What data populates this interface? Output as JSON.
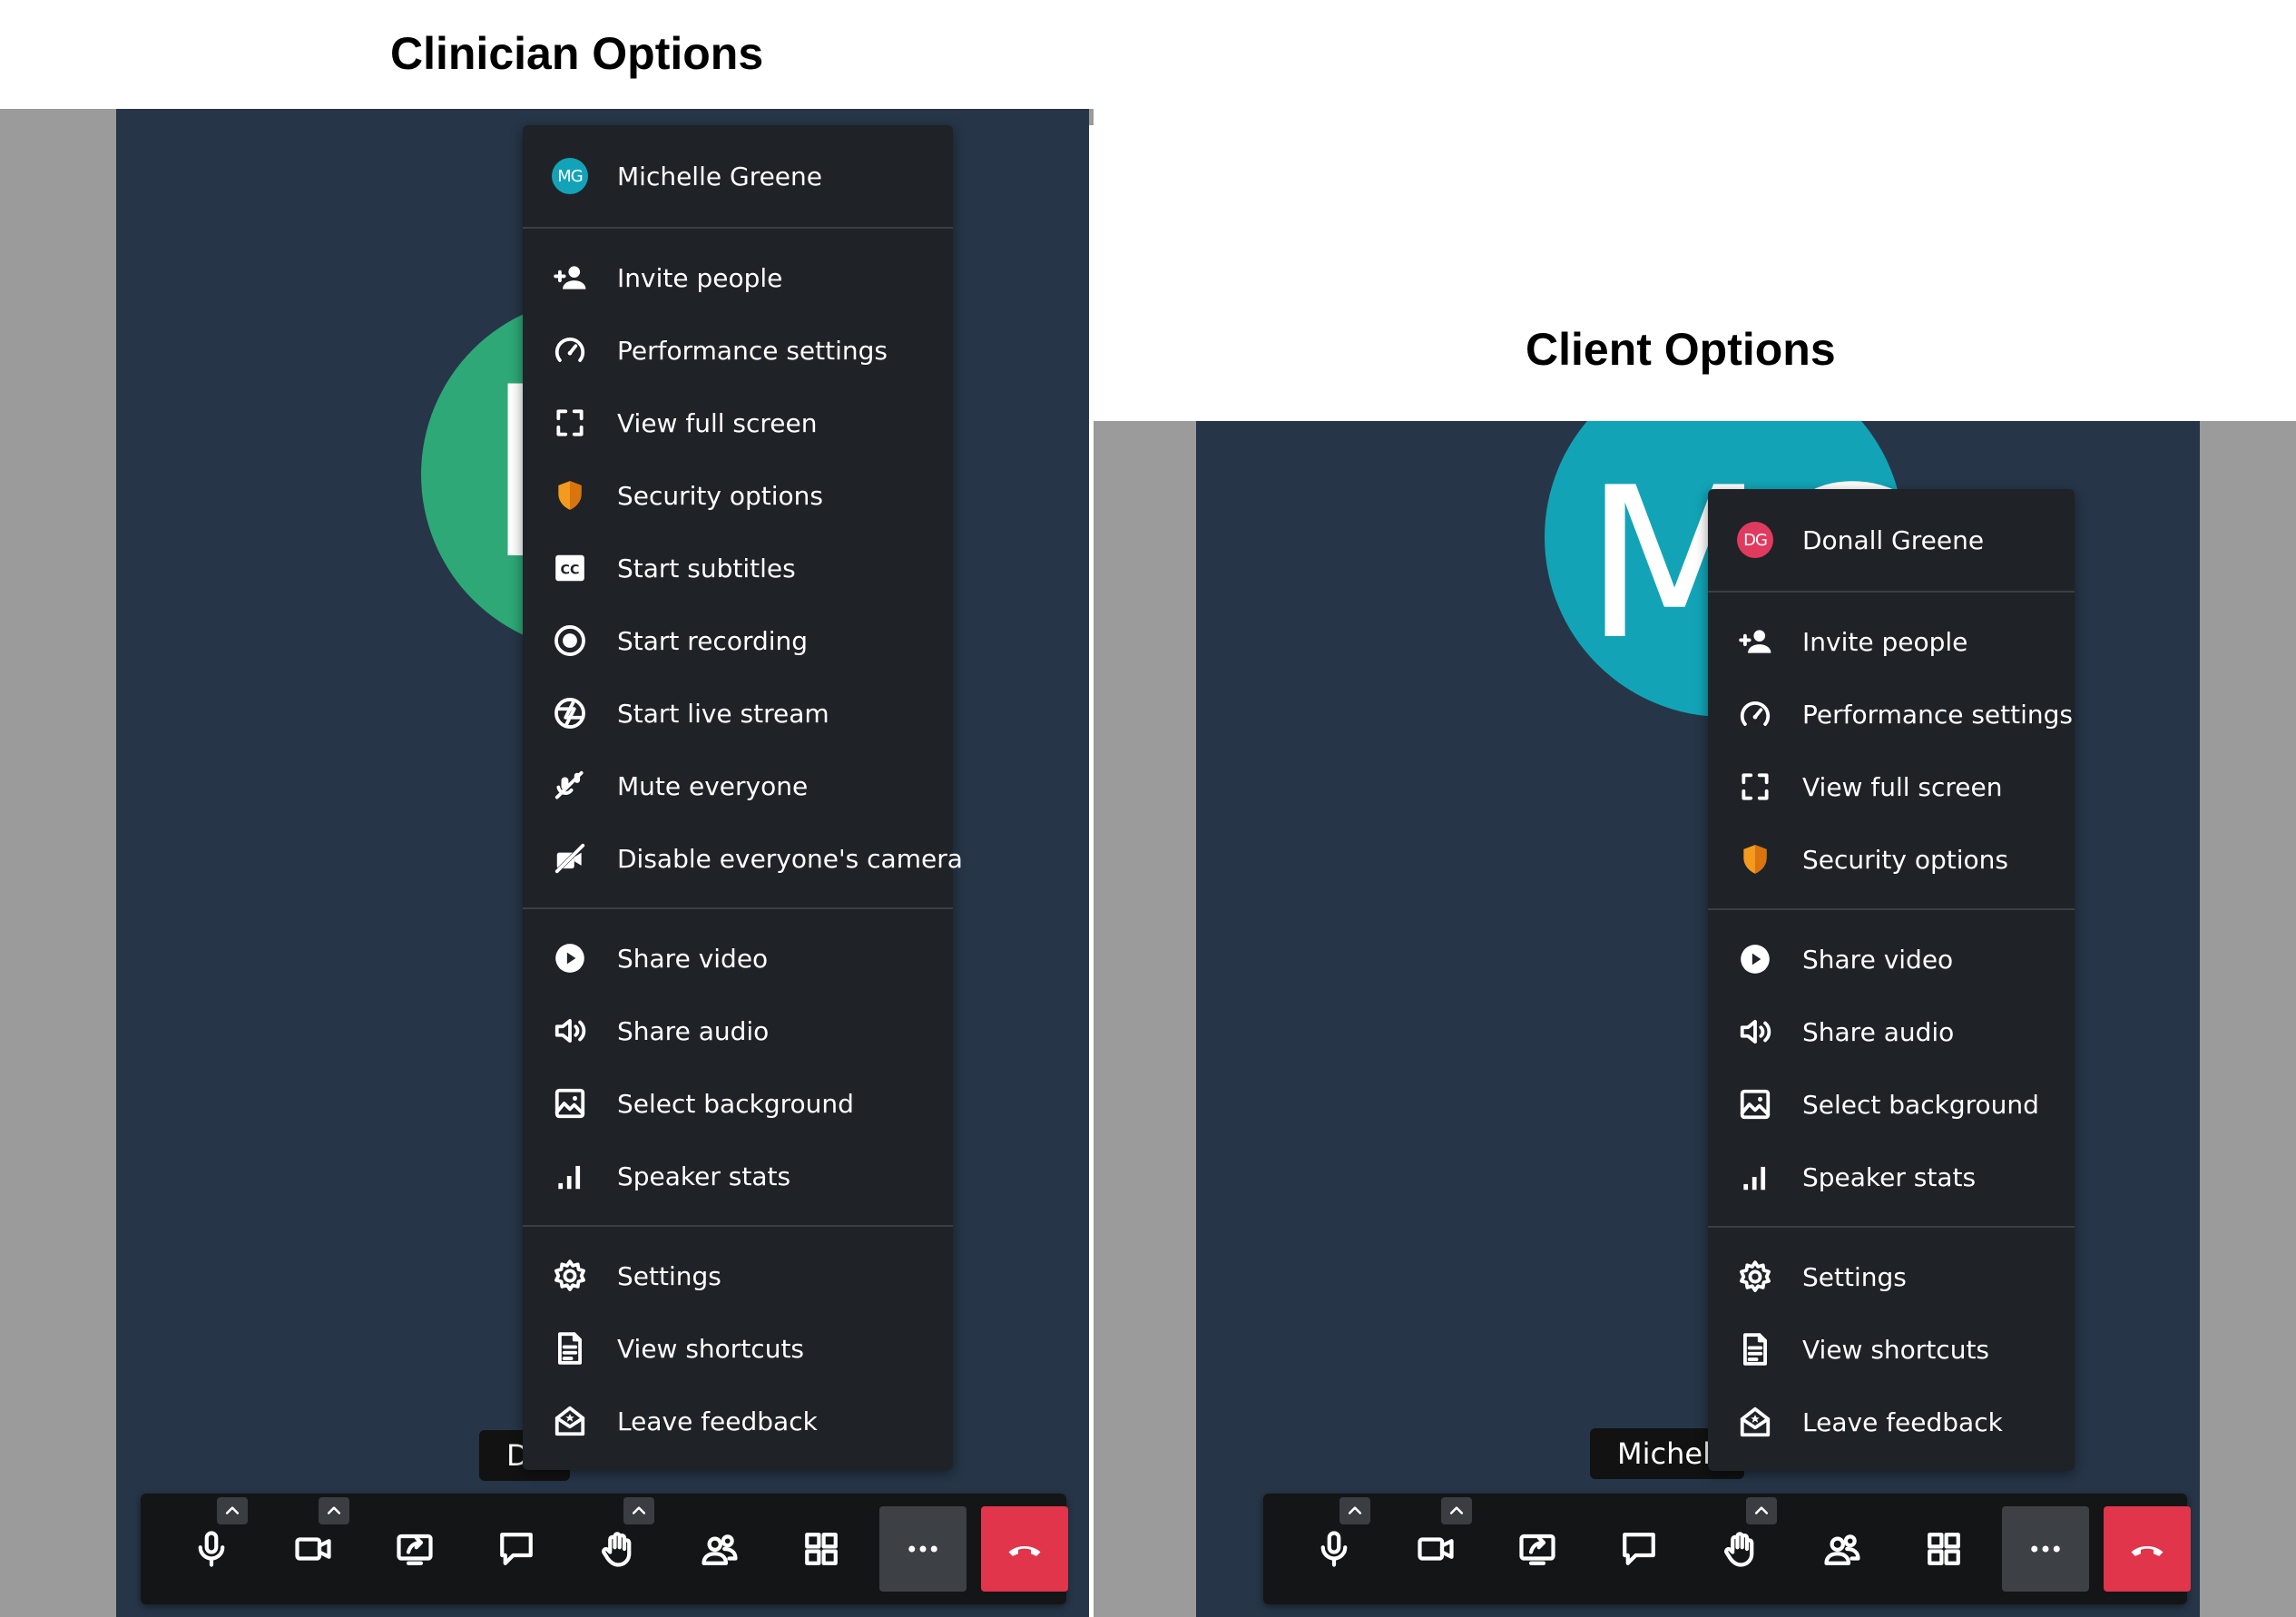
{
  "clinician": {
    "heading": "Clinician Options",
    "avatar": {
      "initials": "D",
      "color": "#2da876"
    },
    "name_tag": "D",
    "menu": {
      "user": {
        "initials": "MG",
        "name": "Michelle Greene",
        "color": "#13a3b8"
      },
      "sections": [
        [
          {
            "label": "Invite people",
            "icon": "add-user-icon"
          },
          {
            "label": "Performance settings",
            "icon": "gauge-icon"
          },
          {
            "label": "View full screen",
            "icon": "fullscreen-icon"
          },
          {
            "label": "Security options",
            "icon": "shield-icon"
          },
          {
            "label": "Start subtitles",
            "icon": "closed-captions-icon"
          },
          {
            "label": "Start recording",
            "icon": "record-icon"
          },
          {
            "label": "Start live stream",
            "icon": "live-stream-icon"
          },
          {
            "label": "Mute everyone",
            "icon": "mute-everyone-icon"
          },
          {
            "label": "Disable everyone's camera",
            "icon": "camera-off-icon"
          }
        ],
        [
          {
            "label": "Share video",
            "icon": "play-icon"
          },
          {
            "label": "Share audio",
            "icon": "speaker-icon"
          },
          {
            "label": "Select background",
            "icon": "image-icon"
          },
          {
            "label": "Speaker stats",
            "icon": "stats-icon"
          }
        ],
        [
          {
            "label": "Settings",
            "icon": "gear-icon"
          },
          {
            "label": "View shortcuts",
            "icon": "document-icon"
          },
          {
            "label": "Leave feedback",
            "icon": "feedback-icon"
          }
        ]
      ]
    }
  },
  "client": {
    "heading": "Client Options",
    "avatar": {
      "initials": "MG",
      "color": "#12a4b6"
    },
    "name_tag": "Michelle",
    "menu": {
      "user": {
        "initials": "DG",
        "name": "Donall Greene",
        "color": "#e03b5f"
      },
      "sections": [
        [
          {
            "label": "Invite people",
            "icon": "add-user-icon"
          },
          {
            "label": "Performance settings",
            "icon": "gauge-icon"
          },
          {
            "label": "View full screen",
            "icon": "fullscreen-icon"
          },
          {
            "label": "Security options",
            "icon": "shield-icon"
          }
        ],
        [
          {
            "label": "Share video",
            "icon": "play-icon"
          },
          {
            "label": "Share audio",
            "icon": "speaker-icon"
          },
          {
            "label": "Select background",
            "icon": "image-icon"
          },
          {
            "label": "Speaker stats",
            "icon": "stats-icon"
          }
        ],
        [
          {
            "label": "Settings",
            "icon": "gear-icon"
          },
          {
            "label": "View shortcuts",
            "icon": "document-icon"
          },
          {
            "label": "Leave feedback",
            "icon": "feedback-icon"
          }
        ]
      ]
    }
  },
  "toolbar": {
    "buttons": [
      {
        "icon": "microphone-icon",
        "caret": true
      },
      {
        "icon": "camera-icon",
        "caret": true
      },
      {
        "icon": "screen-share-icon",
        "caret": false
      },
      {
        "icon": "chat-icon",
        "caret": false
      },
      {
        "icon": "raise-hand-icon",
        "caret": true
      },
      {
        "icon": "participants-icon",
        "caret": false
      },
      {
        "icon": "tile-view-icon",
        "caret": false
      },
      {
        "icon": "more-icon",
        "caret": false
      },
      {
        "icon": "hangup-icon",
        "caret": false
      }
    ]
  }
}
